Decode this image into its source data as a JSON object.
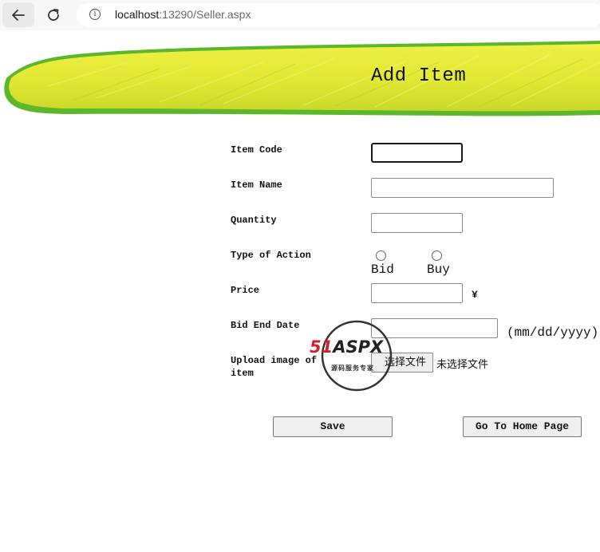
{
  "browser": {
    "url_host": "localhost",
    "url_rest": ":13290/Seller.aspx"
  },
  "banner": {
    "title": "Add Item"
  },
  "form": {
    "item_code_label": "Item Code",
    "item_code_value": "",
    "item_name_label": "Item Name",
    "item_name_value": "",
    "quantity_label": "Quantity",
    "quantity_value": "",
    "type_of_action_label": "Type of Action",
    "action_options": [
      "Bid",
      "Buy"
    ],
    "price_label": "Price",
    "price_value": "",
    "currency_symbol": "¥",
    "bid_end_date_label": "Bid End Date",
    "bid_end_date_value": "",
    "date_format_hint": "(mm/dd/yyyy)",
    "upload_label": "Upload image of item",
    "file_button_label": "选择文件",
    "file_status": "未选择文件"
  },
  "buttons": {
    "save": "Save",
    "home": "Go To Home Page"
  },
  "watermark": {
    "brand_red": "51",
    "brand_dark": "ASPX",
    "tagline": "源码服务专家"
  },
  "colors": {
    "banner_yellow": "#e8ec3a",
    "banner_green": "#5cb82a",
    "watermark_red": "#d0202a"
  }
}
